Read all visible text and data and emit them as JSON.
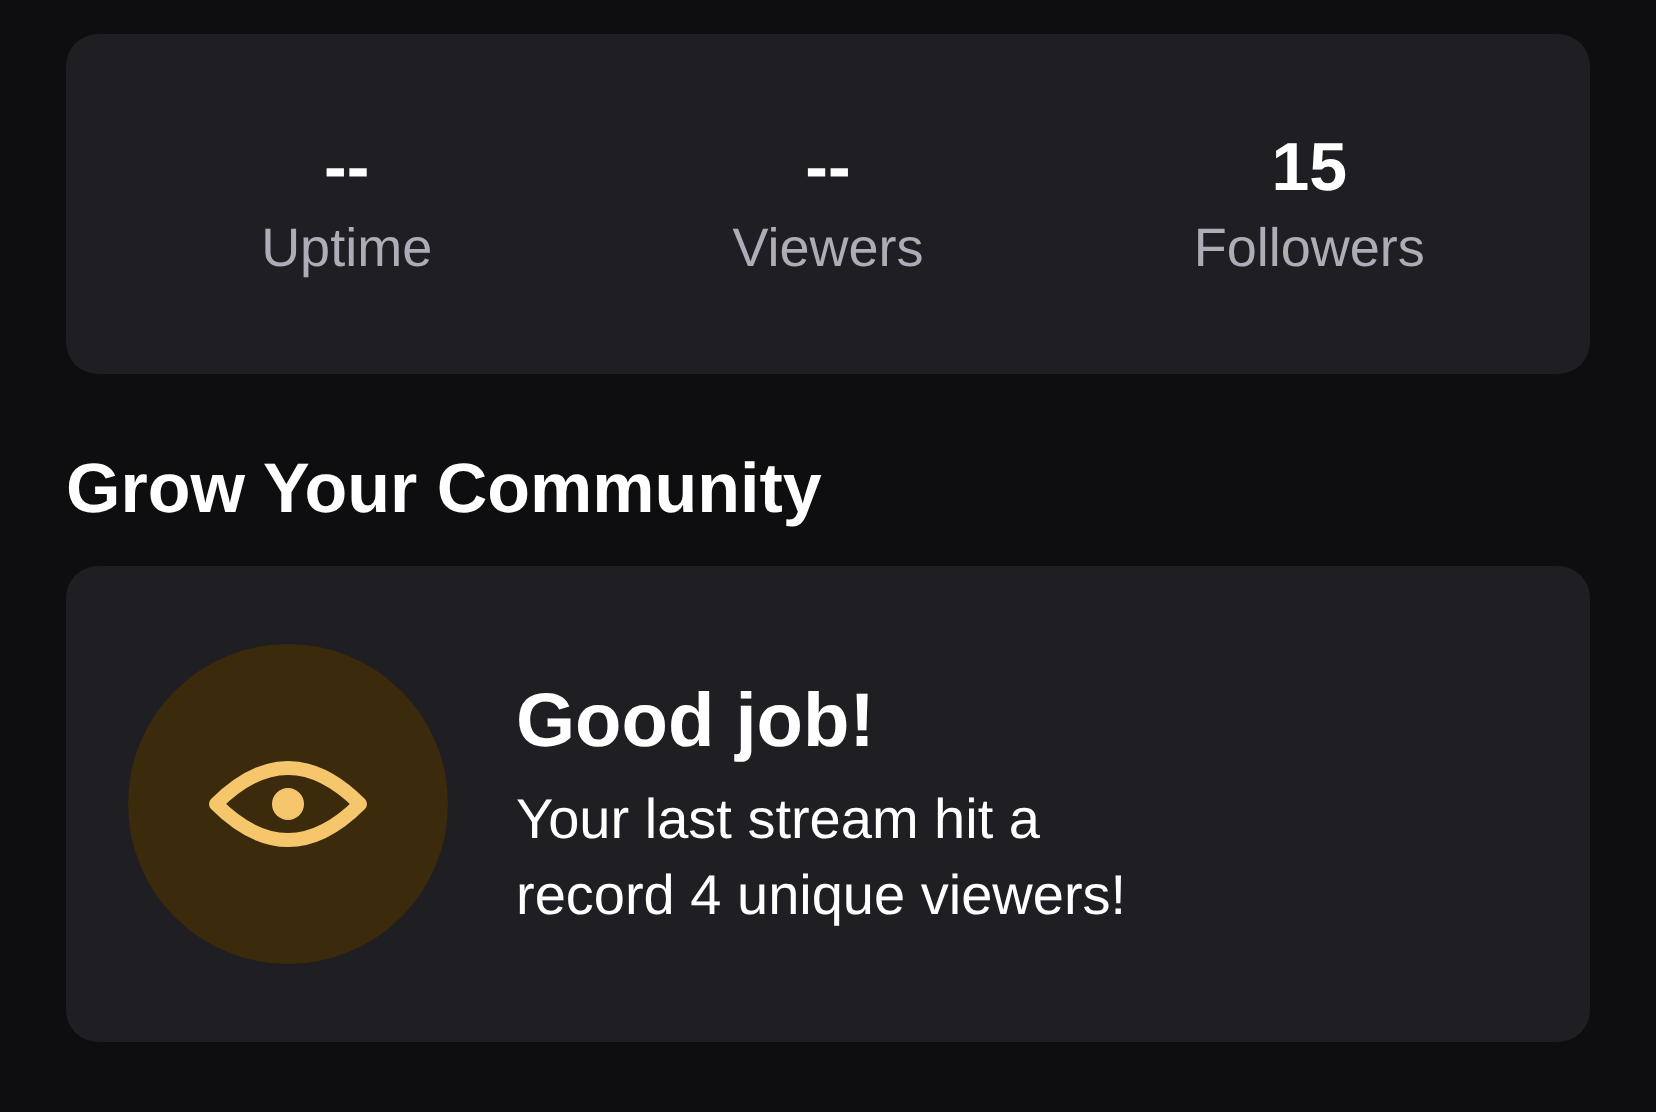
{
  "stats": [
    {
      "value": "--",
      "label": "Uptime"
    },
    {
      "value": "--",
      "label": "Viewers"
    },
    {
      "value": "15",
      "label": "Followers"
    }
  ],
  "section": {
    "title": "Grow Your Community"
  },
  "achievement": {
    "title": "Good job!",
    "message": "Your last stream hit a record 4 unique viewers!"
  }
}
